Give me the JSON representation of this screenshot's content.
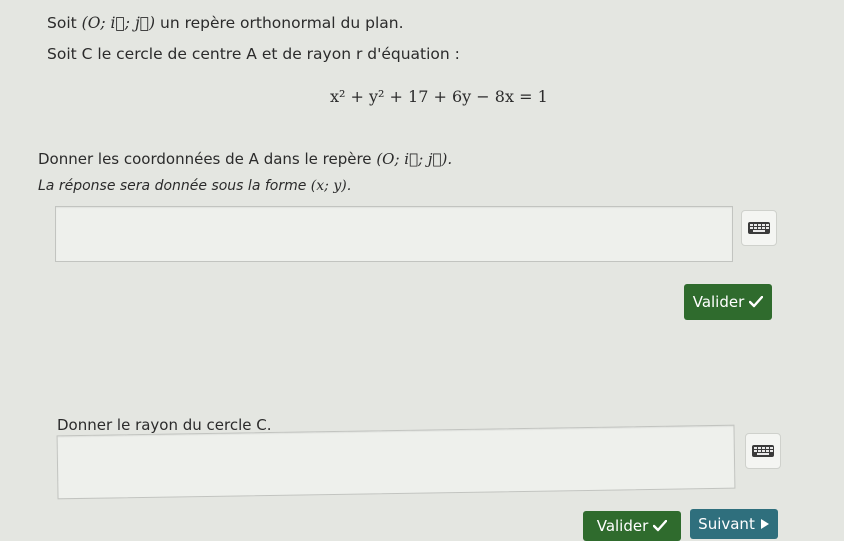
{
  "intro": {
    "line1_prefix": "Soit ",
    "line1_frame": "(O; i⃗; j⃗)",
    "line1_suffix": " un repère orthonormal du plan.",
    "line2": "Soit C le cercle de centre A et de rayon r d'équation :"
  },
  "equation": "x² + y² + 17 + 6y − 8x = 1",
  "question1": {
    "prompt_prefix": "Donner les coordonnées de A dans le repère ",
    "prompt_frame": "(O; i⃗; j⃗).",
    "format_prefix": "La réponse sera donnée sous la forme ",
    "format_math": "(x; y).",
    "answer_value": "",
    "validate_label": "Valider"
  },
  "question2": {
    "prompt": "Donner le rayon du cercle C.",
    "answer_value": "",
    "validate_label": "Valider"
  },
  "next_label": "Suivant",
  "icons": {
    "check": "check-icon",
    "next": "play-icon",
    "keyboard": "keyboard-icon"
  },
  "colors": {
    "validate_button": "#2f6b2d",
    "next_button": "#2f6f7d"
  }
}
